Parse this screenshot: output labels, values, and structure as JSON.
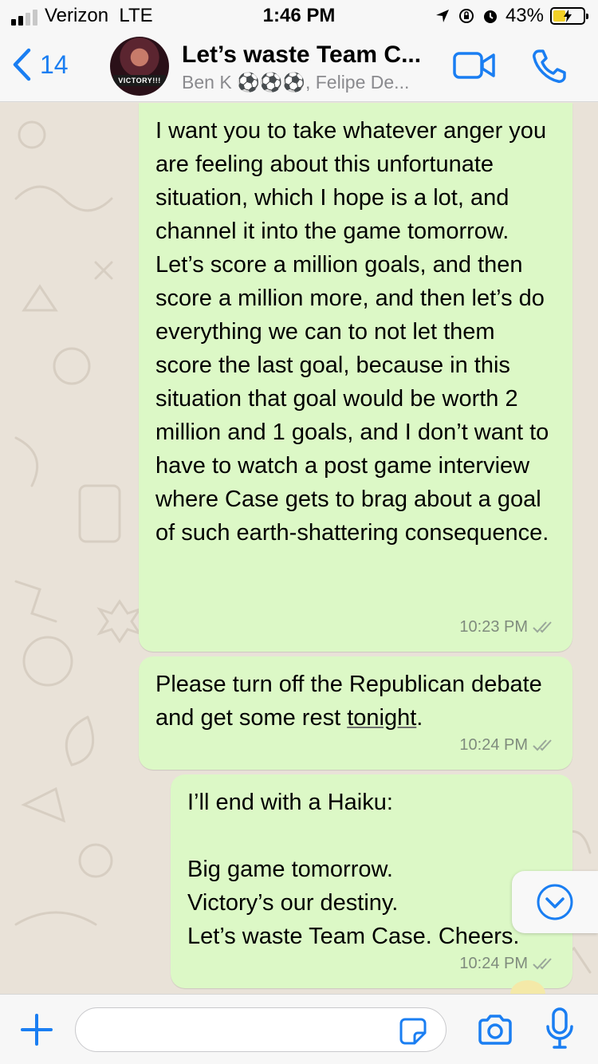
{
  "status_bar": {
    "carrier": "Verizon",
    "network": "LTE",
    "time": "1:46 PM",
    "battery_percent": "43%",
    "battery_level": 0.43,
    "signal_bars": 2,
    "signal_total": 4,
    "icons": [
      "location-arrow-icon",
      "orientation-lock-icon",
      "alarm-icon",
      "charging-bolt-icon"
    ],
    "battery_color": "#f2d027"
  },
  "header": {
    "back_count": "14",
    "title": "Let’s waste Team C...",
    "subtitle": "Ben K ⚽⚽⚽, Felipe De...",
    "avatar_banner": "VICTORY!!!",
    "accent_color": "#1a7ef2",
    "icons": [
      "chevron-left-icon",
      "video-camera-icon",
      "phone-icon"
    ]
  },
  "messages": [
    {
      "text": "I want you to take whatever anger you are feeling about this unfortunate situation, which I hope is a lot, and channel it into the game tomorrow. Let’s score a million goals, and then score a million more, and then let’s do everything we can to not let them score the last goal, because in this situation that goal would be worth 2 million and 1 goals, and I don’t want to have to watch a post game interview where Case gets to brag about a goal of such earth-shattering consequence.",
      "time": "10:23 PM",
      "status": "read"
    },
    {
      "text_before": "Please turn off the Republican debate and get some rest ",
      "text_underlined": "tonight",
      "text_after": ".",
      "time": "10:24 PM",
      "status": "read"
    },
    {
      "text": "I’ll end with a Haiku:\n\nBig game tomorrow.\nVictory’s our destiny.\nLet’s waste Team Case. Cheers.",
      "time": "10:24 PM",
      "status": "read"
    }
  ],
  "bubble_color": "#dcf8c6",
  "input": {
    "value": "",
    "placeholder": ""
  }
}
